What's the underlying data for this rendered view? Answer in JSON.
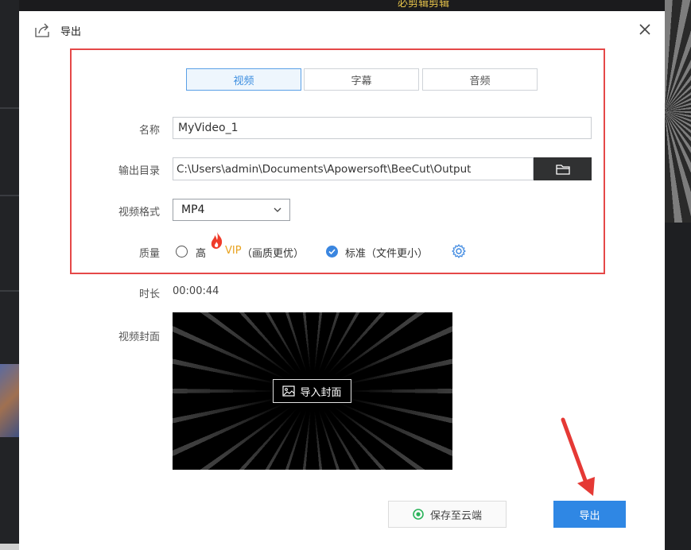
{
  "background": {
    "top_title": "必剪辑剪辑"
  },
  "dialog": {
    "title": "导出",
    "close_symbol": "✕"
  },
  "tabs": [
    {
      "label": "视频",
      "active": true
    },
    {
      "label": "字幕",
      "active": false
    },
    {
      "label": "音频",
      "active": false
    }
  ],
  "form": {
    "name_label": "名称",
    "name_value": "MyVideo_1",
    "dir_label": "输出目录",
    "dir_value": "C:\\Users\\admin\\Documents\\Apowersoft\\BeeCut\\Output",
    "format_label": "视频格式",
    "format_value": "MP4",
    "quality_label": "质量",
    "quality_high": "高",
    "quality_high_vip": "VIP",
    "quality_high_note": "（画质更优）",
    "quality_standard": "标准（文件更小）",
    "quality_selected": "standard",
    "duration_label": "时长",
    "duration_value": "00:00:44",
    "cover_label": "视频封面",
    "import_cover_label": "导入封面"
  },
  "buttons": {
    "save_cloud": "保存至云端",
    "export": "导出"
  },
  "colors": {
    "accent": "#2f87e4",
    "highlight_border": "#e54848",
    "vip": "#e8a320",
    "cloud_icon": "#2bb35a",
    "dark_button": "#303132"
  },
  "icons": {
    "export": "export-icon",
    "close": "close-icon",
    "folder": "folder-icon",
    "chevron": "chevron-down-icon",
    "fire": "fire-icon",
    "settings": "gear-icon",
    "image": "image-icon",
    "cloud": "cloud-save-icon"
  }
}
